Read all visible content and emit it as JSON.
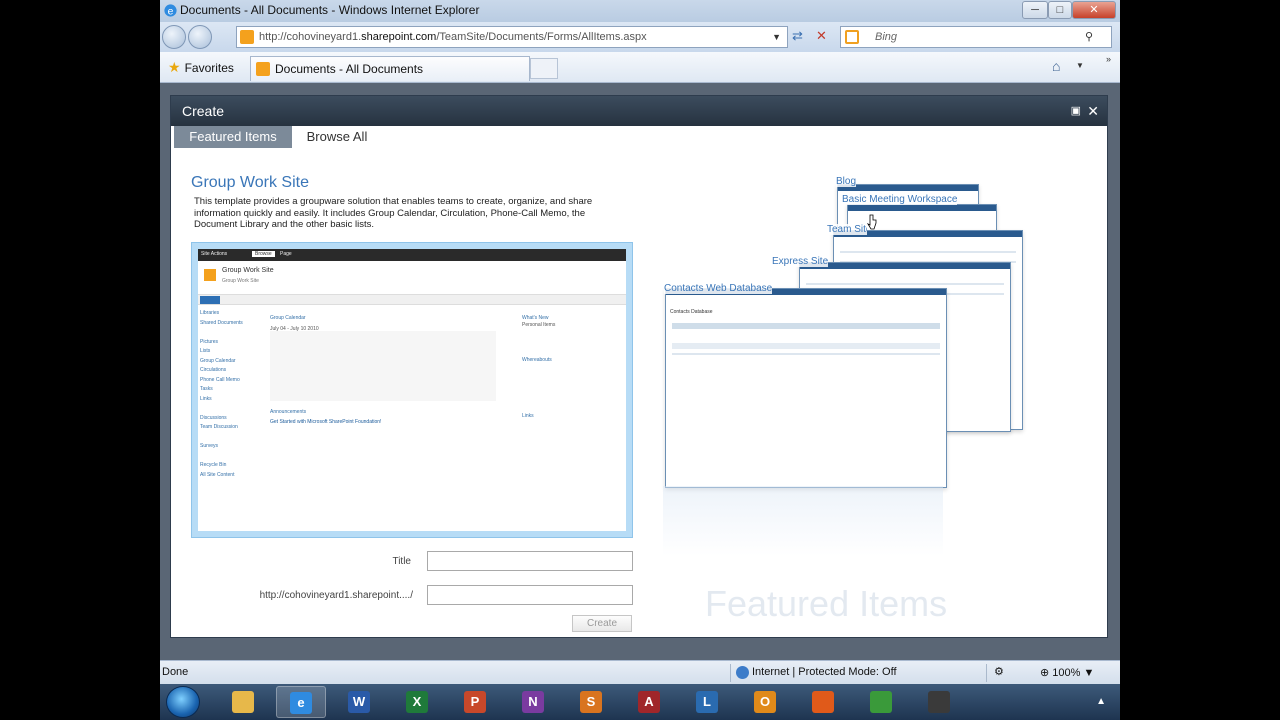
{
  "window": {
    "title": "Documents - All Documents - Windows Internet Explorer"
  },
  "address": {
    "url_prefix": "http://cohovineyard1.",
    "url_domain": "sharepoint.com",
    "url_path": "/TeamSite/Documents/Forms/AllItems.aspx",
    "search_placeholder": "Bing"
  },
  "favorites": {
    "label": "Favorites",
    "tab_title": "Documents - All Documents"
  },
  "dialog": {
    "title": "Create",
    "tabs": [
      {
        "label": "Featured Items"
      },
      {
        "label": "Browse All"
      }
    ],
    "template": {
      "name": "Group Work Site",
      "description": "This template provides a groupware solution that enables teams to create, organize, and share information quickly and easily. It includes Group Calendar, Circulation, Phone-Call Memo, the Document Library and the other basic lists."
    },
    "preview": {
      "site_title": "Group Work Site",
      "site_subtitle": "Group Work Site",
      "ribbon_tabs": [
        "Site Actions",
        "Browse",
        "Page"
      ],
      "left_nav": [
        "Libraries",
        "Shared Documents",
        "",
        "Pictures",
        "Lists",
        "Group Calendar",
        "Circulations",
        "Phone Call Memo",
        "Tasks",
        "Links",
        "",
        "Discussions",
        "Team Discussion",
        "",
        "Surveys",
        "",
        "Recycle Bin",
        "All Site Content"
      ],
      "calendar_title": "Group Calendar",
      "calendar_range": "July 04 - July 10 2010",
      "whats_new": "What's New",
      "personal_items": "Personal Items",
      "whereabouts": "Whereabouts",
      "links": "Links",
      "announcements": "Announcements",
      "announcement_item": "Get Started with Microsoft SharePoint Foundation!"
    },
    "form": {
      "title_label": "Title",
      "url_label": "http://cohovineyard1.sharepoint..../",
      "title_value": "",
      "url_value": "",
      "create_label": "Create"
    },
    "carousel": [
      "Blog",
      "Basic Meeting Workspace",
      "Team Site",
      "Express Site",
      "Contacts Web Database"
    ],
    "contacts_db_heading": "Contacts Database",
    "watermark": "Featured Items"
  },
  "status": {
    "done": "Done",
    "zone": "Internet | Protected Mode: Off",
    "zoom": "100%"
  },
  "taskbar": {
    "apps": [
      {
        "icon": "explorer-icon",
        "glyph": "",
        "color": "#e7b84a"
      },
      {
        "icon": "internet-explorer-icon",
        "glyph": "e",
        "color": "#2f8be0"
      },
      {
        "icon": "word-icon",
        "glyph": "W",
        "color": "#2a5aa8"
      },
      {
        "icon": "excel-icon",
        "glyph": "X",
        "color": "#1f7a3a"
      },
      {
        "icon": "powerpoint-icon",
        "glyph": "P",
        "color": "#c8482a"
      },
      {
        "icon": "onenote-icon",
        "glyph": "N",
        "color": "#7a3ba0"
      },
      {
        "icon": "sharepoint-workspace-icon",
        "glyph": "S",
        "color": "#d9741f"
      },
      {
        "icon": "access-icon",
        "glyph": "A",
        "color": "#a0262a"
      },
      {
        "icon": "lync-icon",
        "glyph": "L",
        "color": "#2a6bb0"
      },
      {
        "icon": "outlook-icon",
        "glyph": "O",
        "color": "#e08a1a"
      },
      {
        "icon": "firefox-icon",
        "glyph": "",
        "color": "#e05a1a"
      },
      {
        "icon": "chrome-icon",
        "glyph": "",
        "color": "#3a9a3a"
      },
      {
        "icon": "tool-icon",
        "glyph": "",
        "color": "#3a3a3a"
      }
    ]
  }
}
